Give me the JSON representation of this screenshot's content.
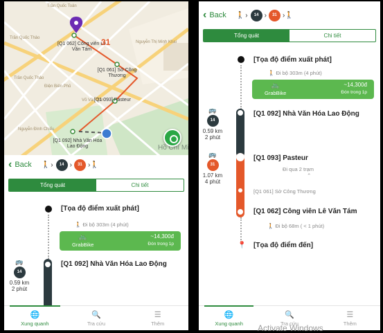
{
  "left": {
    "map": {
      "markers": {
        "m_062": "[Q1 062] Công viên Lê Văn Tám",
        "m_061": "[Q1 061] Sở Công Thương",
        "m_093": "[Q1 093] Pasteur",
        "m_092": "[Q1 092] Nhà Văn Hóa Lao Động"
      },
      "route_number": "31",
      "streets": {
        "s1": "Trần Quốc Toản",
        "s2": "Trần Quốc Thảo",
        "s3": "Võ Văn Tần",
        "s4": "Nguyễn Đình Chiểu",
        "s5": "Điện Biên Phủ",
        "s6": "Nguyễn Thị Minh Khai",
        "s7": "Trần Quốc Thảo",
        "s8": "Hồ Chí Minh"
      }
    },
    "back": "Back",
    "bus1": "14",
    "bus2": "31",
    "tab_overview": "Tổng quát",
    "tab_detail": "Chi tiết",
    "start": "[Tọa độ điểm xuất phát]",
    "walk": "Đi bộ 303m (4 phút)",
    "grab_name": "GrabBike",
    "grab_price": "~14,300đ",
    "grab_pickup": "Đón trong 1p",
    "stop_092": "[Q1 092] Nhà Văn Hóa Lao Động",
    "side_bus": "14",
    "side_dist": "0.59 km",
    "side_time": "2 phút"
  },
  "right": {
    "back": "Back",
    "bus1": "14",
    "bus2": "31",
    "tab_overview": "Tổng quát",
    "tab_detail": "Chi tiết",
    "start": "[Tọa độ điểm xuất phát]",
    "walk1": "Đi bộ 303m (4 phút)",
    "grab_name": "GrabBike",
    "grab_price": "~14,300đ",
    "grab_pickup": "Đón trong 1p",
    "stop_092": "[Q1 092] Nhà Văn Hóa Lao Động",
    "side1_bus": "14",
    "side1_dist": "0.59 km",
    "side1_time": "2 phút",
    "stop_093": "[Q1 093] Pasteur",
    "via": "Đi qua 2 trạm",
    "stop_061": "[Q1 061] Sở Công Thương",
    "side2_bus": "31",
    "side2_dist": "1.07 km",
    "side2_time": "4 phút",
    "stop_062": "[Q1 062] Công viên Lê Văn Tám",
    "walk2": "Đi bộ 68m ( < 1 phút)",
    "end": "[Tọa độ điểm đến]"
  },
  "nav": {
    "nearby": "Xung quanh",
    "lookup": "Tra cứu",
    "more": "Thêm"
  },
  "watermark": "Activate Windows",
  "colors": {
    "accent": "#2e8b3e",
    "route_dark": "#2c3a3f",
    "route_orange": "#e4582a",
    "grab": "#5cb84f"
  }
}
